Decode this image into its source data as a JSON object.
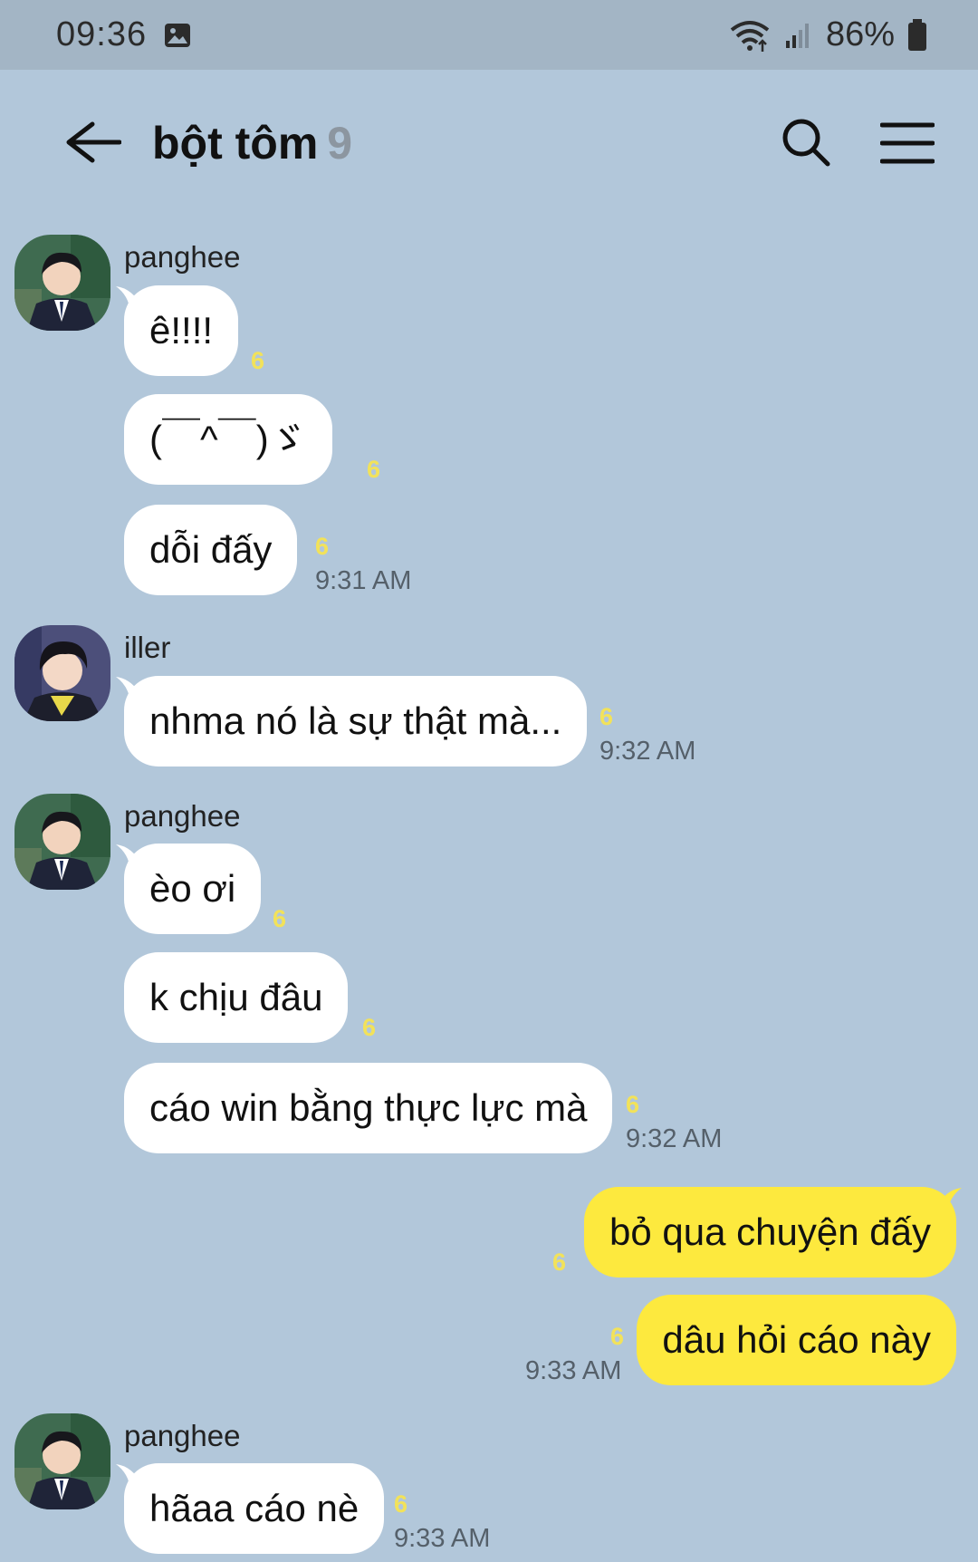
{
  "status_bar": {
    "time": "09:36",
    "battery": "86%",
    "icons": [
      "image-icon",
      "wifi-icon",
      "signal-icon",
      "battery-icon"
    ]
  },
  "header": {
    "title": "bột tôm",
    "member_count": "9",
    "icons": [
      "back-arrow-icon",
      "search-icon",
      "menu-icon"
    ]
  },
  "colors": {
    "background": "#b2c7da",
    "incoming_bubble": "#ffffff",
    "outgoing_bubble": "#fde93e",
    "read_count": "#f2e25a"
  },
  "messages": [
    {
      "sender": "panghee",
      "text": "ê!!!!",
      "read": "6",
      "time": ""
    },
    {
      "sender": "",
      "text": "(￣^￣)ゞ",
      "read": "6",
      "time": ""
    },
    {
      "sender": "",
      "text": "dỗi đấy",
      "read": "6",
      "time": "9:31 AM"
    },
    {
      "sender": "iller",
      "text": "nhma nó là sự thật mà...",
      "read": "6",
      "time": "9:32 AM"
    },
    {
      "sender": "panghee",
      "text": "èo ơi",
      "read": "6",
      "time": ""
    },
    {
      "sender": "",
      "text": "k chịu đâu",
      "read": "6",
      "time": ""
    },
    {
      "sender": "",
      "text": "cáo win bằng thực lực mà",
      "read": "6",
      "time": "9:32 AM"
    },
    {
      "sender": "me",
      "text": "bỏ qua chuyện đấy",
      "read": "6",
      "time": ""
    },
    {
      "sender": "me",
      "text": "dâu hỏi cáo này",
      "read": "6",
      "time": "9:33 AM"
    },
    {
      "sender": "panghee",
      "text": "hãaa cáo nè",
      "read": "6",
      "time": "9:33 AM"
    }
  ]
}
